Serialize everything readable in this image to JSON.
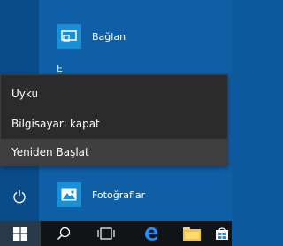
{
  "start_menu": {
    "tiles": [
      {
        "label": "Bağlan",
        "icon": "connect-icon"
      },
      {
        "label": "Fotoğraflar",
        "icon": "photos-icon"
      }
    ],
    "group_letter": "E"
  },
  "power_menu": {
    "items": [
      {
        "label": "Uyku"
      },
      {
        "label": "Bilgisayarı kapat"
      },
      {
        "label": "Yeniden Başlat",
        "highlighted": true
      }
    ]
  },
  "taskbar": {
    "items": [
      {
        "icon": "windows-start-icon"
      },
      {
        "icon": "search-icon"
      },
      {
        "icon": "task-view-icon"
      },
      {
        "icon": "edge-icon"
      },
      {
        "icon": "file-explorer-icon"
      },
      {
        "icon": "store-icon"
      }
    ]
  },
  "colors": {
    "accent": "#1a8fd6",
    "menu_bg": "#2b2b2b",
    "menu_hover": "#3f3f3f",
    "taskbar_bg": "#101417"
  }
}
